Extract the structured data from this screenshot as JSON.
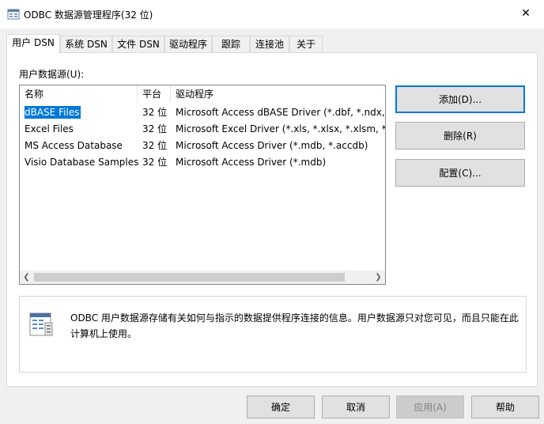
{
  "window": {
    "title": "ODBC 数据源管理程序(32 位)",
    "close_glyph": "✕"
  },
  "tabs": [
    {
      "label": "用户 DSN",
      "active": true
    },
    {
      "label": "系统 DSN"
    },
    {
      "label": "文件 DSN"
    },
    {
      "label": "驱动程序"
    },
    {
      "label": "跟踪"
    },
    {
      "label": "连接池"
    },
    {
      "label": "关于"
    }
  ],
  "user_dsn": {
    "group_label": "用户数据源(U):",
    "columns": [
      "名称",
      "平台",
      "驱动程序"
    ],
    "rows": [
      {
        "name": "dBASE Files",
        "platform": "32 位",
        "driver": "Microsoft Access dBASE Driver (*.dbf, *.ndx, *",
        "selected": true
      },
      {
        "name": "Excel Files",
        "platform": "32 位",
        "driver": "Microsoft Excel Driver (*.xls, *.xlsx, *.xlsm, *.xls"
      },
      {
        "name": "MS Access Database",
        "platform": "32 位",
        "driver": "Microsoft Access Driver (*.mdb, *.accdb)"
      },
      {
        "name": "Visio Database Samples",
        "platform": "32 位",
        "driver": "Microsoft Access Driver (*.mdb)"
      }
    ],
    "scroll_left_glyph": "❮",
    "scroll_right_glyph": "❯",
    "buttons": {
      "add": "添加(D)...",
      "remove": "删除(R)",
      "configure": "配置(C)..."
    },
    "info_text": "ODBC 用户数据源存储有关如何与指示的数据提供程序连接的信息。用户数据源只对您可见，而且只能在此计算机上使用。"
  },
  "dialog_buttons": {
    "ok": "确定",
    "cancel": "取消",
    "apply": "应用(A)",
    "help": "帮助"
  },
  "colors": {
    "selection": "#0078d7",
    "default_button_border": "#0078d7"
  }
}
